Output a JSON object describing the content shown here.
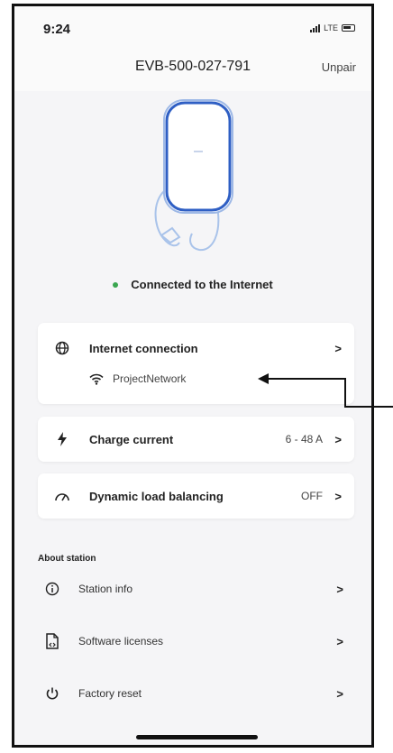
{
  "status_bar": {
    "time": "9:24",
    "network": "LTE"
  },
  "header": {
    "device_id": "EVB-500-027-791",
    "unpair_label": "Unpair"
  },
  "connection_status": "Connected to the Internet",
  "settings": {
    "internet": {
      "label": "Internet connection",
      "network_name": "ProjectNetwork"
    },
    "charge_current": {
      "label": "Charge current",
      "value": "6 - 48 A"
    },
    "load_balancing": {
      "label": "Dynamic load balancing",
      "value": "OFF"
    }
  },
  "about": {
    "title": "About station",
    "items": [
      {
        "label": "Station info",
        "icon": "info-icon"
      },
      {
        "label": "Software licenses",
        "icon": "document-icon"
      },
      {
        "label": "Factory reset",
        "icon": "power-icon"
      }
    ]
  },
  "chevron": ">",
  "colors": {
    "status_dot": "#3aa650",
    "charger_outline": "#2f5fc4",
    "cable": "#a9c3ea"
  }
}
